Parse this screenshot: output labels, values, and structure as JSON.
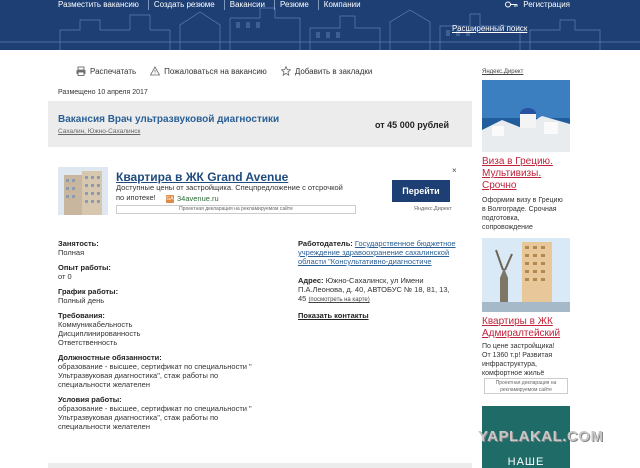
{
  "header": {
    "nav": [
      "Разместить вакансию",
      "Создать резюме",
      "Вакансии",
      "Резюме",
      "Компании"
    ],
    "register": "Регистрация",
    "advanced_search": "Расширенный поиск"
  },
  "actions": {
    "print": "Распечатать",
    "complain": "Пожаловаться на вакансию",
    "bookmark": "Добавить в закладки"
  },
  "posted": "Размещено 10 апреля 2017",
  "vacancy": {
    "title": "Вакансия Врач ультразвуковой диагностики",
    "location": "Сахалин, Южно-Сахалинск",
    "salary": "от 45 000 рублей"
  },
  "ad": {
    "title": "Квартира в ЖК Grand Avenue",
    "desc_line1": "Доступные цены от застройщика. Спецпредложение с отсрочкой",
    "desc_line2": "по ипотеке!",
    "domain": "34avenue.ru",
    "fav": "GA",
    "declaration": "Проектная декларация на рекламируемом сайте",
    "button": "Перейти",
    "close": "×",
    "yandex": "Яндекс.Директ"
  },
  "details": {
    "employment_label": "Занятость:",
    "employment": "Полная",
    "experience_label": "Опыт работы:",
    "experience": "от 0",
    "schedule_label": "График работы:",
    "schedule": "Полный день",
    "requirements_label": "Требования:",
    "requirements": [
      "Коммуникабельность",
      "Дисциплинированность",
      "Ответственность"
    ],
    "duties_label": "Должностные обязанности:",
    "duties": [
      "образование - высшее, сертификат по специальности \"",
      "Ультразвуковая диагностика\", стаж работы по",
      "специальности желателен"
    ],
    "conditions_label": "Условия работы:",
    "conditions": [
      "образование - высшее, сертификат по специальности \"",
      "Ультразвуковая диагностика\", стаж работы по",
      "специальности желателен"
    ]
  },
  "employer": {
    "label": "Работодатель:",
    "name_lines": [
      "Государственное бюджетное",
      "учреждение здравоохранение сахалинской",
      "области \"Консультативно-диагностиче"
    ],
    "address_label": "Адрес:",
    "address_lines": [
      "Южно-Сахалинск, ул Имени",
      "П.А.Леонова, д. 40, АВТОБУС № 18, 81, 13,",
      "45"
    ],
    "map_link": "(посмотреть на карте)",
    "show_contacts": "Показать контакты"
  },
  "sidebar": {
    "label": "Яндекс.Директ",
    "ad1_title": [
      "Виза в Грецию.",
      "Мультивизы.",
      "Срочно"
    ],
    "ad1_text": [
      "Оформим визу в Грецию",
      "в Волгограде. Срочная",
      "подготовка,",
      "сопровождение"
    ],
    "ad2_title": [
      "Квартиры в ЖК",
      "Адмиралтейский"
    ],
    "ad2_text": [
      "По цене застройщика!",
      "От 1360 т.р! Развитая",
      "инфраструктура,",
      "комфортное жильё"
    ],
    "ad2_declaration": "Проектная декларация на рекламируемом сайте",
    "teal_text": "НАШЕ"
  },
  "watermark": "YAPLAKAL.COM",
  "colors": {
    "header_bg": "#1d3f74",
    "link": "#2a5f95",
    "side_ad_title": "#c0223a",
    "button_bg": "#1d3f74"
  }
}
